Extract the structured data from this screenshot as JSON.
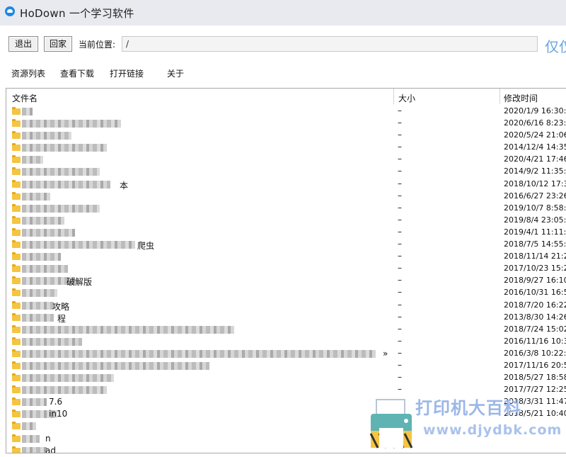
{
  "window": {
    "title": "HoDown 一个学习软件"
  },
  "toolbar": {
    "exit_label": "退出",
    "home_label": "回家",
    "location_label": "当前位置:",
    "location_value": "/",
    "side_text": "仅仅"
  },
  "menu": {
    "items": [
      "资源列表",
      "查看下载",
      "打开链接",
      "关于"
    ]
  },
  "file_list": {
    "columns": [
      "文件名",
      "大小",
      "修改时间"
    ],
    "rows": [
      {
        "suffix": "",
        "size": "–",
        "time": "2020/1/9 16:30:"
      },
      {
        "suffix": "",
        "size": "–",
        "time": "2020/6/16 8:23:"
      },
      {
        "suffix": "",
        "size": "–",
        "time": "2020/5/24 21:06"
      },
      {
        "suffix": "",
        "size": "–",
        "time": "2014/12/4 14:35"
      },
      {
        "suffix": "",
        "size": "–",
        "time": "2020/4/21 17:46"
      },
      {
        "suffix": "",
        "size": "–",
        "time": "2014/9/2 11:35:"
      },
      {
        "suffix": "本",
        "size": "–",
        "time": "2018/10/12 17:3"
      },
      {
        "suffix": "",
        "size": "–",
        "time": "2016/6/27 23:26"
      },
      {
        "suffix": "",
        "size": "–",
        "time": "2019/10/7 8:58:"
      },
      {
        "suffix": "",
        "size": "–",
        "time": "2019/8/4 23:05:"
      },
      {
        "suffix": "",
        "size": "–",
        "time": "2019/4/1 11:11:"
      },
      {
        "suffix": "爬虫",
        "size": "–",
        "time": "2018/7/5 14:55:"
      },
      {
        "suffix": "",
        "size": "–",
        "time": "2018/11/14 21:2"
      },
      {
        "suffix": "",
        "size": "–",
        "time": "2017/10/23 15:2"
      },
      {
        "suffix": "破解版",
        "size": "–",
        "time": "2018/9/27 16:10"
      },
      {
        "suffix": "",
        "size": "–",
        "time": "2016/10/31 16:5"
      },
      {
        "suffix": "攻略",
        "size": "–",
        "time": "2018/7/20 16:22"
      },
      {
        "suffix": "程",
        "size": "–",
        "time": "2013/8/30 14:26"
      },
      {
        "suffix": "",
        "size": "–",
        "time": "2018/7/24 15:02"
      },
      {
        "suffix": "",
        "size": "–",
        "time": "2016/11/16 10:3"
      },
      {
        "suffix": "»",
        "size": "–",
        "time": "2016/3/8 10:22:"
      },
      {
        "suffix": "",
        "size": "–",
        "time": "2017/11/16 20:5"
      },
      {
        "suffix": "",
        "size": "–",
        "time": "2018/5/27 18:58"
      },
      {
        "suffix": "",
        "size": "–",
        "time": "2017/7/27 12:25"
      },
      {
        "suffix": "7.6",
        "size": "–",
        "time": "2018/3/31 11:47"
      },
      {
        "suffix": "in10",
        "size": "–",
        "time": "2018/5/21 10:40"
      },
      {
        "suffix": "",
        "size": "",
        "time": ""
      },
      {
        "suffix": "n",
        "size": "",
        "time": ""
      },
      {
        "suffix": "ad",
        "size": "",
        "time": ""
      }
    ]
  },
  "watermark": {
    "line1": "打印机大百科",
    "line2": "www.djydbk.com"
  },
  "colors": {
    "titlebar": "#e8eaf0",
    "folder": "#f4c542",
    "accent": "#1e88e5",
    "watermark": "#9bb7e8"
  }
}
